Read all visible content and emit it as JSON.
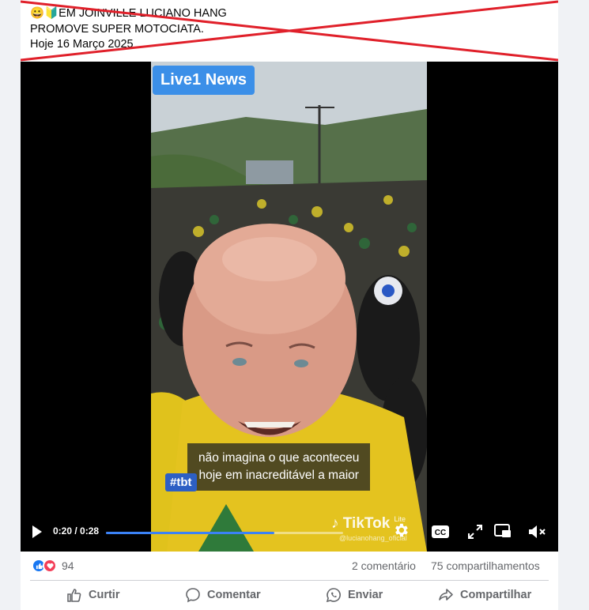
{
  "post": {
    "line1": "😀🔰EM JOINVILLE LUCIANO HANG",
    "line2": "PROMOVE SUPER MOTOCIATA.",
    "line3": "Hoje 16 Março 2025"
  },
  "video": {
    "badge": "Live1 News",
    "subtitle_line1": "não imagina o que aconteceu",
    "subtitle_line2": "hoje em inacreditável a maior",
    "hashtag": "#tbt",
    "watermark": "TikTok",
    "watermark_sub": "Lite",
    "watermark_user": "@lucianohang_oficial",
    "time": "0:20 / 0:28",
    "progress": 0.71,
    "cc_label": "CC"
  },
  "stats": {
    "reactions_count": "94",
    "comments": "2 comentário",
    "shares": "75 compartilhamentos"
  },
  "actions": {
    "like": "Curtir",
    "comment": "Comentar",
    "send": "Enviar",
    "share": "Compartilhar"
  },
  "colors": {
    "cross": "#e0202a",
    "badge": "#3b8fe8",
    "progress": "#3b82f6",
    "like": "#1877f2",
    "love": "#f33e58"
  }
}
